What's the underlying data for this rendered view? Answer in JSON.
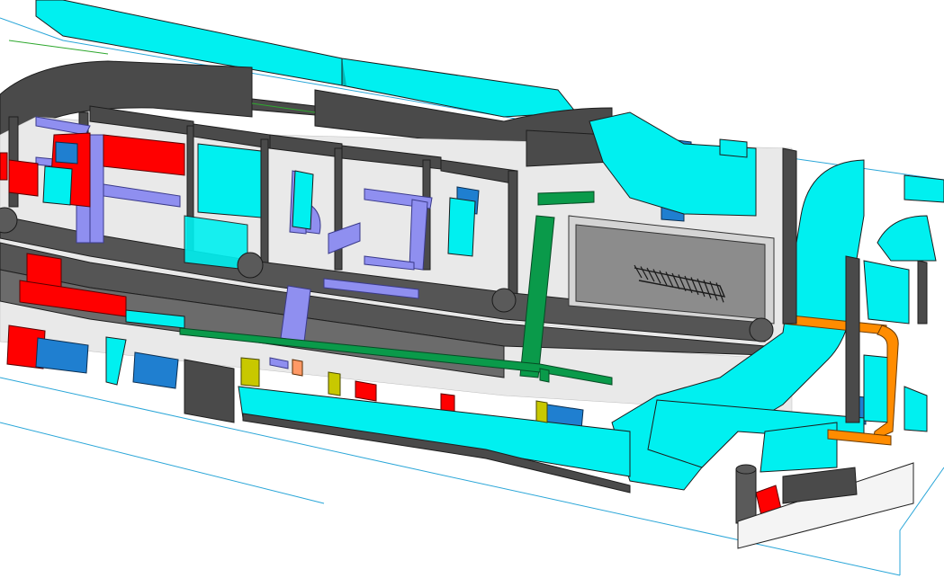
{
  "colors": {
    "background": "#ffffff",
    "wall": "#4a4a4a",
    "wall_edge": "#1e1e1e",
    "floor": "#e9e9e9",
    "corridor": "#555555",
    "duct_supply": "#00f0f0",
    "duct_return": "#8f8ff0",
    "fan_unit": "#ff0000",
    "equipment_blue": "#1f7fd0",
    "green_pipe": "#0a9a4a",
    "orange_pipe": "#ff8c00",
    "yellow_box": "#c8c800",
    "stair": "#8c8c8c",
    "bounding_line": "#2aa6d8",
    "grid_line": "#2ea82e"
  },
  "legend_icon": "bim-3d-building-services-model"
}
